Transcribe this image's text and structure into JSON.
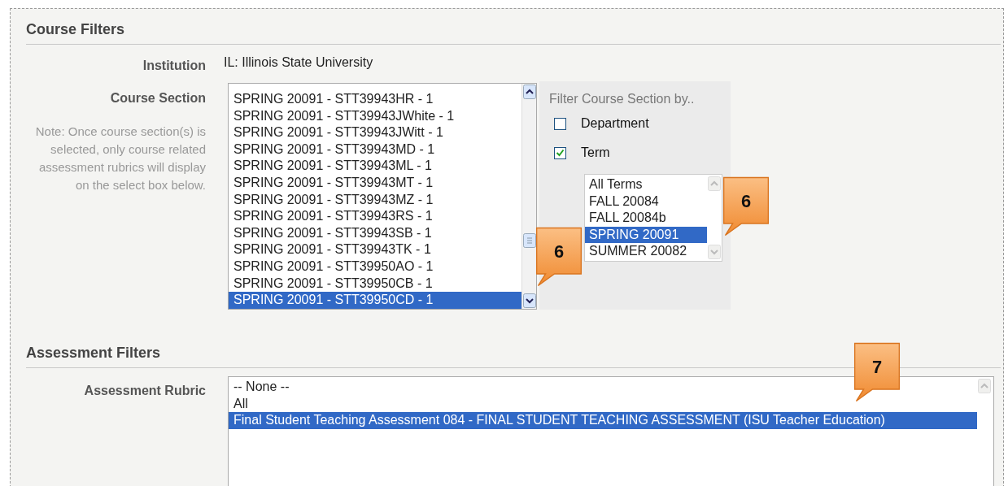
{
  "course_filters": {
    "title": "Course Filters",
    "institution": {
      "label": "Institution",
      "value": "IL: Illinois State University"
    },
    "course_section": {
      "label": "Course Section",
      "note": "Note: Once course section(s) is selected, only course related assessment rubrics will display on the select box below.",
      "options": [
        {
          "label": "SPRING 20091 - STT39943HR - 1",
          "selected": false
        },
        {
          "label": "SPRING 20091 - STT39943JWhite - 1",
          "selected": false
        },
        {
          "label": "SPRING 20091 - STT39943JWitt - 1",
          "selected": false
        },
        {
          "label": "SPRING 20091 - STT39943MD - 1",
          "selected": false
        },
        {
          "label": "SPRING 20091 - STT39943ML - 1",
          "selected": false
        },
        {
          "label": "SPRING 20091 - STT39943MT - 1",
          "selected": false
        },
        {
          "label": "SPRING 20091 - STT39943MZ - 1",
          "selected": false
        },
        {
          "label": "SPRING 20091 - STT39943RS - 1",
          "selected": false
        },
        {
          "label": "SPRING 20091 - STT39943SB - 1",
          "selected": false
        },
        {
          "label": "SPRING 20091 - STT39943TK - 1",
          "selected": false
        },
        {
          "label": "SPRING 20091 - STT39950AO - 1",
          "selected": false
        },
        {
          "label": "SPRING 20091 - STT39950CB - 1",
          "selected": false
        },
        {
          "label": "SPRING 20091 - STT39950CD - 1",
          "selected": true
        }
      ]
    },
    "filter_panel": {
      "title": "Filter Course Section by..",
      "checkboxes": [
        {
          "label": "Department",
          "checked": false
        },
        {
          "label": "Term",
          "checked": true
        }
      ],
      "terms": [
        {
          "label": "All Terms",
          "selected": false
        },
        {
          "label": "FALL 20084",
          "selected": false
        },
        {
          "label": "FALL 20084b",
          "selected": false
        },
        {
          "label": "SPRING 20091",
          "selected": true
        },
        {
          "label": "SUMMER 20082",
          "selected": false
        }
      ]
    }
  },
  "assessment_filters": {
    "title": "Assessment Filters",
    "rubric": {
      "label": "Assessment Rubric",
      "options": [
        {
          "label": "-- None --",
          "selected": false
        },
        {
          "label": "All",
          "selected": false
        },
        {
          "label": "Final Student Teaching Assessment 084 - FINAL STUDENT TEACHING ASSESSMENT (ISU Teacher Education)",
          "selected": true
        }
      ]
    }
  },
  "callouts": [
    {
      "number": "6"
    },
    {
      "number": "6"
    },
    {
      "number": "7"
    }
  ]
}
